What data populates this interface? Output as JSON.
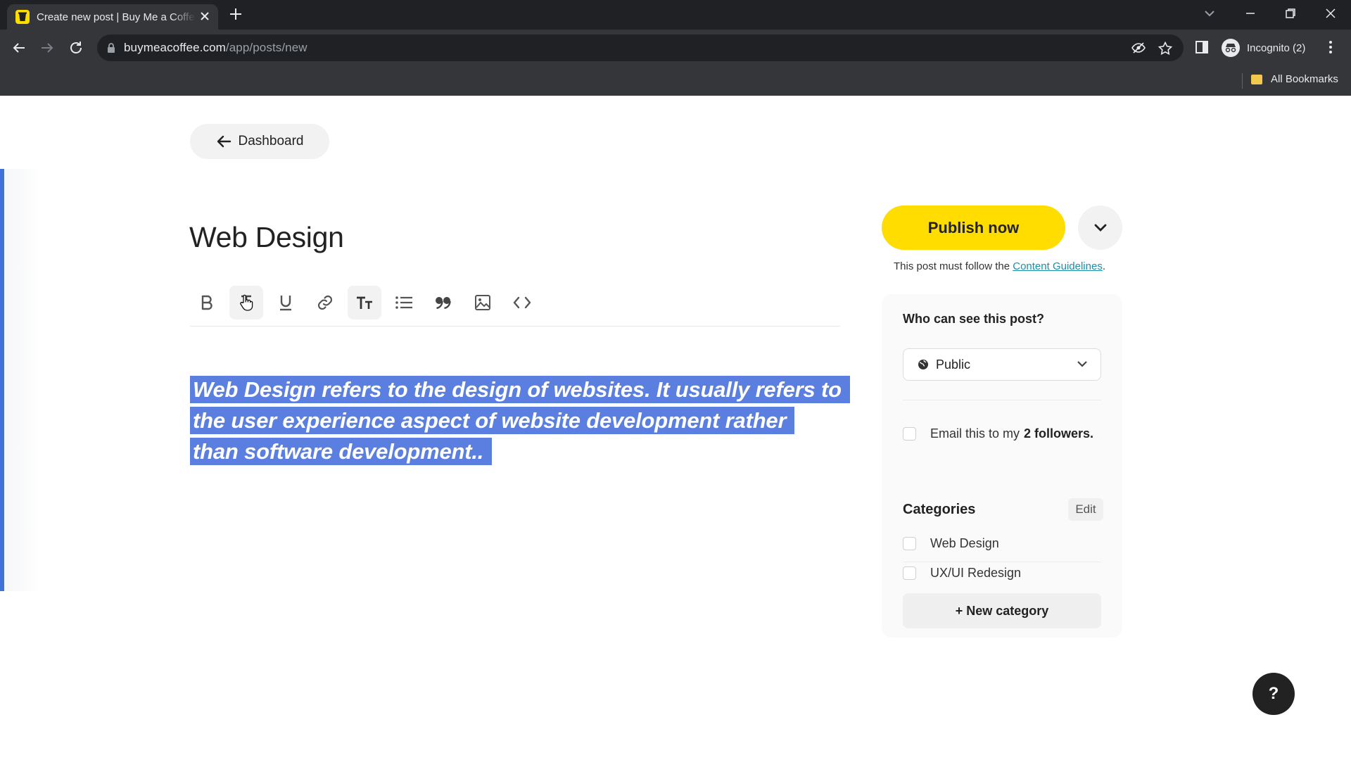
{
  "browser": {
    "tab_title": "Create new post | Buy Me a Coffee",
    "url_domain": "buymeacoffee.com",
    "url_path": "/app/posts/new",
    "profile_label": "Incognito (2)",
    "bookmarks_label": "All Bookmarks"
  },
  "page": {
    "back_label": "Dashboard",
    "post_title": "Web Design",
    "body_lines": [
      "Web Design refers to the design of websites. It usually refers to",
      "the user experience aspect of website development rather",
      "than software development.."
    ],
    "toolbar_icons": [
      "bold-icon",
      "strikethrough-icon",
      "underline-icon",
      "link-icon",
      "text-size-icon",
      "bulleted-list-icon",
      "quote-icon",
      "image-icon",
      "code-icon"
    ]
  },
  "sidebar": {
    "publish_label": "Publish now",
    "guideline_prefix": "This post must follow the ",
    "guideline_link": "Content Guidelines",
    "guideline_suffix": ".",
    "visibility_heading": "Who can see this post?",
    "visibility_value": "Public",
    "email_prefix": "Email this to my",
    "email_count": "2 followers.",
    "categories_heading": "Categories",
    "edit_label": "Edit",
    "categories": [
      "Web Design",
      "UX/UI Redesign"
    ],
    "new_category_label": "+ New category"
  },
  "help_label": "?",
  "colors": {
    "brand_yellow": "#FFDD00",
    "selection": "#5b7fe0",
    "link": "#1a8fa8"
  }
}
